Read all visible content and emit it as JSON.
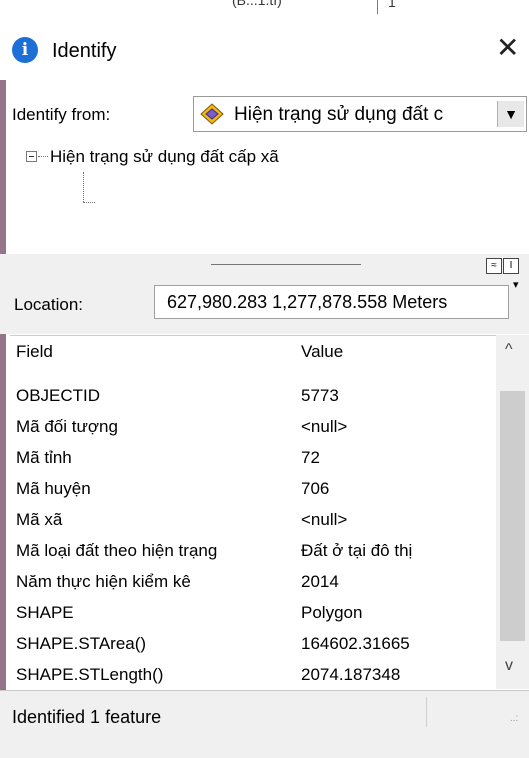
{
  "top_strip": {
    "fragment": "(B...1.tî)",
    "fragment2": "1"
  },
  "window": {
    "title": "Identify",
    "close": "✕",
    "info_glyph": "i"
  },
  "identify_from": {
    "label": "Identify from:",
    "value": "Hiện trạng sử dụng đất c",
    "dropdown": "▼"
  },
  "tree": {
    "layer": "Hiện trạng sử dụng đất cấp xã"
  },
  "splitter": {
    "btn1": "≈",
    "btn2": "I"
  },
  "location": {
    "label": "Location:",
    "value": "627,980.283  1,277,878.558 Meters",
    "dropdown": "▾"
  },
  "table": {
    "headers": {
      "field": "Field",
      "value": "Value"
    },
    "rows": [
      {
        "field": "OBJECTID",
        "value": "5773"
      },
      {
        "field": "Mã đối tượng",
        "value": "<null>"
      },
      {
        "field": "Mã tỉnh",
        "value": "72"
      },
      {
        "field": "Mã huyện",
        "value": "706"
      },
      {
        "field": "Mã xã",
        "value": "<null>"
      },
      {
        "field": "Mã loại đất theo hiện trạng",
        "value": "Đất ở tại đô thị"
      },
      {
        "field": "Năm thực hiện kiểm kê",
        "value": "2014"
      },
      {
        "field": "SHAPE",
        "value": "Polygon"
      },
      {
        "field": "SHAPE.STArea()",
        "value": "164602.31665"
      },
      {
        "field": "SHAPE.STLength()",
        "value": "2074.187348"
      }
    ]
  },
  "scrollbar": {
    "up": "^",
    "down": "v"
  },
  "status": {
    "text": "Identified 1 feature",
    "grip": "..:"
  },
  "colors": {
    "info_blue": "#1c6fd6",
    "chrome": "#f0f0f0",
    "scroll_thumb": "#cdcdcd"
  },
  "icons": {
    "info": "info-icon",
    "layer": "layer-diamond-icon",
    "close": "close-icon"
  }
}
